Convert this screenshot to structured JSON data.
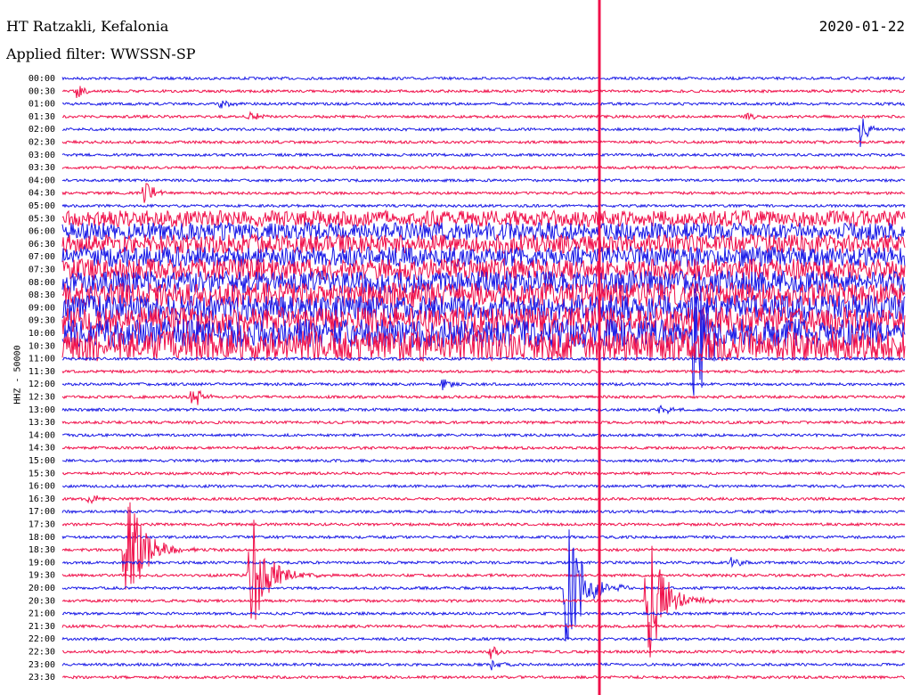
{
  "header": {
    "station": "HT Ratzakli, Kefalonia",
    "filter": "Applied filter: WWSSN-SP",
    "date": "2020-01-22"
  },
  "chart_data": {
    "type": "line",
    "title": "HT Ratzakli, Kefalonia",
    "subtitle": "Applied filter: WWSSN-SP",
    "date": "2020-01-22",
    "ylabel": "HHZ - 50000",
    "xlabel": "",
    "rows": [
      "00:00",
      "00:30",
      "01:00",
      "01:30",
      "02:00",
      "02:30",
      "03:00",
      "03:30",
      "04:00",
      "04:30",
      "05:00",
      "05:30",
      "06:00",
      "06:30",
      "07:00",
      "07:30",
      "08:00",
      "08:30",
      "09:00",
      "09:30",
      "10:00",
      "10:30",
      "11:00",
      "11:30",
      "12:00",
      "12:30",
      "13:00",
      "13:30",
      "14:00",
      "14:30",
      "15:00",
      "15:30",
      "16:00",
      "16:30",
      "17:00",
      "17:30",
      "18:00",
      "18:30",
      "19:00",
      "19:30",
      "20:00",
      "20:30",
      "21:00",
      "21:30",
      "22:00",
      "22:30",
      "23:00",
      "23:30"
    ],
    "series_colors": [
      "#1a1ae6",
      "#f0104a"
    ],
    "events": [
      {
        "row": "00:30",
        "minute": 0.5,
        "amplitude": "medium"
      },
      {
        "row": "01:00",
        "minute": 5.6,
        "amplitude": "medium"
      },
      {
        "row": "01:30",
        "minute": 6.6,
        "amplitude": "medium"
      },
      {
        "row": "01:30",
        "minute": 24.3,
        "amplitude": "medium"
      },
      {
        "row": "02:00",
        "minute": 28.4,
        "amplitude": "large"
      },
      {
        "row": "04:30",
        "minute": 2.9,
        "amplitude": "large"
      },
      {
        "row": "10:00",
        "minute": 22.4,
        "amplitude": "very large"
      },
      {
        "row": "12:00",
        "minute": 13.5,
        "amplitude": "medium"
      },
      {
        "row": "12:30",
        "minute": 4.6,
        "amplitude": "large"
      },
      {
        "row": "13:00",
        "minute": 21.3,
        "amplitude": "medium"
      },
      {
        "row": "16:30",
        "minute": 0.9,
        "amplitude": "medium"
      },
      {
        "row": "18:30",
        "minute": 2.2,
        "amplitude": "very large"
      },
      {
        "row": "19:00",
        "minute": 23.8,
        "amplitude": "medium"
      },
      {
        "row": "19:30",
        "minute": 6.6,
        "amplitude": "very large"
      },
      {
        "row": "20:00",
        "minute": 17.9,
        "amplitude": "very large"
      },
      {
        "row": "20:30",
        "minute": 20.8,
        "amplitude": "very large"
      },
      {
        "row": "22:30",
        "minute": 15.2,
        "amplitude": "medium"
      },
      {
        "row": "23:00",
        "minute": 15.2,
        "amplitude": "medium"
      }
    ]
  }
}
